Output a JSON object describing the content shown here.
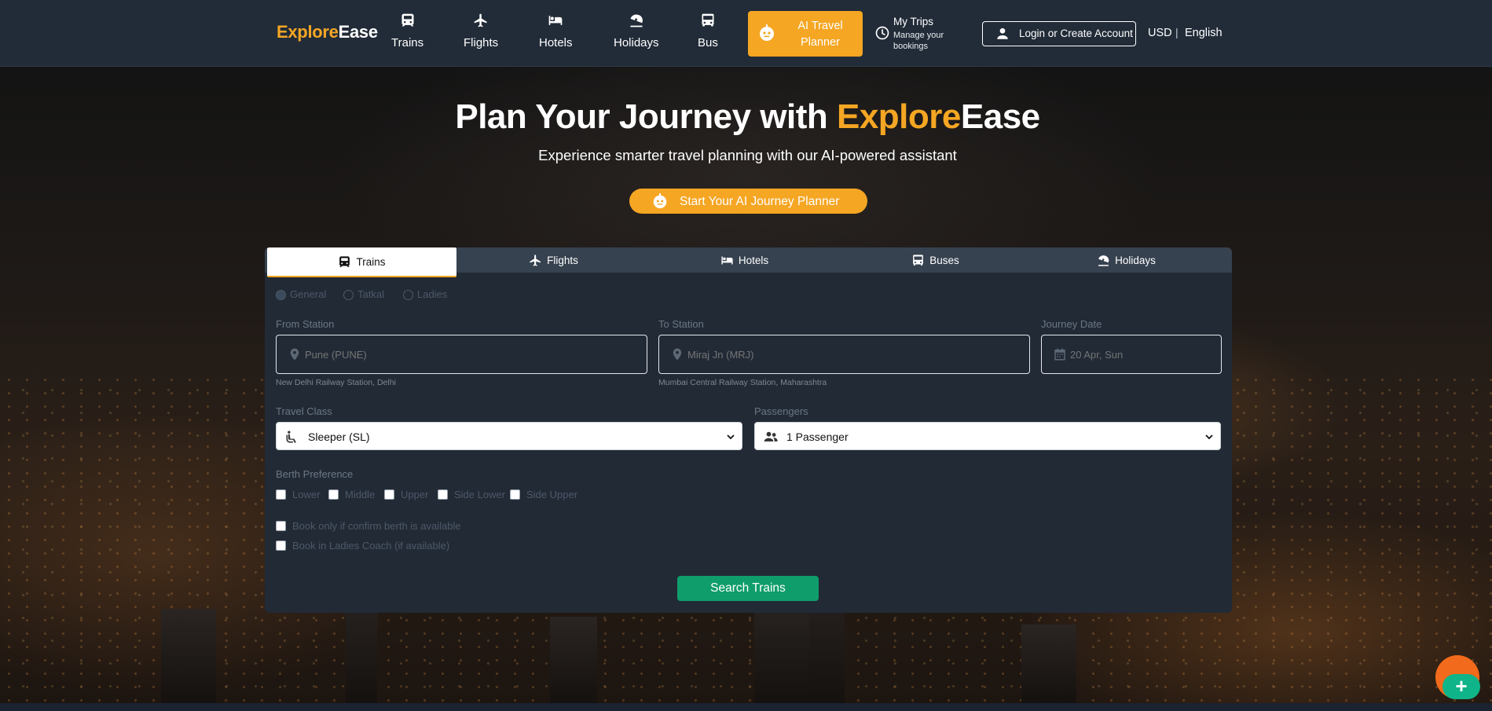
{
  "brand": {
    "part1": "Explore",
    "part2": "Ease"
  },
  "nav": {
    "items": [
      {
        "label": "Trains",
        "icon": "train-icon"
      },
      {
        "label": "Flights",
        "icon": "plane-icon"
      },
      {
        "label": "Hotels",
        "icon": "bed-icon"
      },
      {
        "label": "Holidays",
        "icon": "umbrella-beach-icon"
      },
      {
        "label": "Bus",
        "icon": "bus-icon"
      }
    ],
    "ai_planner": {
      "line1": "AI Travel",
      "line2": "Planner"
    },
    "my_trips": {
      "title": "My Trips",
      "subtitle": "Manage your bookings"
    },
    "login": "Login or Create Account",
    "currency": "USD",
    "separator": "|",
    "language": "English"
  },
  "hero": {
    "title_prefix": "Plan Your Journey with ",
    "title_highlight": "Explore",
    "title_suffix": "Ease",
    "subtitle": "Experience smarter travel planning with our AI-powered assistant",
    "cta": "Start Your AI Journey Planner"
  },
  "search": {
    "tabs": [
      {
        "label": "Trains",
        "icon": "train-icon",
        "active": true
      },
      {
        "label": "Flights",
        "icon": "plane-icon",
        "active": false
      },
      {
        "label": "Hotels",
        "icon": "bed-icon",
        "active": false
      },
      {
        "label": "Buses",
        "icon": "bus-icon",
        "active": false
      },
      {
        "label": "Holidays",
        "icon": "umbrella-beach-icon",
        "active": false
      }
    ],
    "quota_options": [
      {
        "label": "General",
        "selected": true
      },
      {
        "label": "Tatkal",
        "selected": false
      },
      {
        "label": "Ladies",
        "selected": false
      }
    ],
    "from": {
      "label": "From Station",
      "placeholder": "Pune (PUNE)",
      "hint": "New Delhi Railway Station, Delhi"
    },
    "to": {
      "label": "To Station",
      "placeholder": "Miraj Jn (MRJ)",
      "hint": "Mumbai Central Railway Station, Maharashtra"
    },
    "date": {
      "label": "Journey Date",
      "placeholder": "20 Apr, Sun"
    },
    "travel_class": {
      "label": "Travel Class",
      "value": "Sleeper (SL)"
    },
    "passengers": {
      "label": "Passengers",
      "value": "1 Passenger"
    },
    "berth": {
      "label": "Berth Preference",
      "options": [
        "Lower",
        "Middle",
        "Upper",
        "Side Lower",
        "Side Upper"
      ]
    },
    "extras": [
      "Book only if confirm berth is available",
      "Book in Ladies Coach (if available)"
    ],
    "submit": "Search Trains"
  },
  "fab": {
    "label": "+"
  },
  "colors": {
    "accent": "#f5a623",
    "navbar": "#222c38",
    "card": "#222a36",
    "search_button": "#0f9d6b",
    "fab_orange": "#f26a1b",
    "fab_green": "#0fb489"
  }
}
